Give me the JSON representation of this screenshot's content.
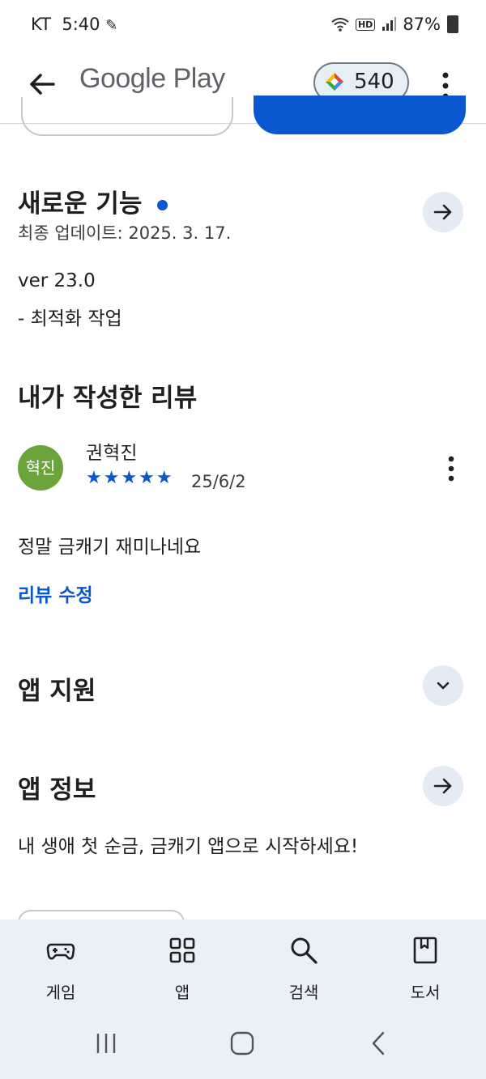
{
  "status_bar": {
    "carrier": "KT",
    "time": "5:40",
    "battery": "87%"
  },
  "app_bar": {
    "title": "Google Play",
    "points": "540"
  },
  "whats_new": {
    "title": "새로운 기능",
    "updated": "최종 업데이트: 2025. 3. 17.",
    "version": "ver 23.0",
    "note": "- 최적화 작업"
  },
  "my_review": {
    "title": "내가 작성한 리뷰",
    "avatar_text": "혁진",
    "reviewer": "권혁진",
    "stars": "★★★★★",
    "rating": 5,
    "date": "25/6/2",
    "text": "정말 금캐기 재미나네요",
    "edit_label": "리뷰 수정"
  },
  "app_support": {
    "title": "앱 지원"
  },
  "app_info": {
    "title": "앱 정보",
    "description": "내 생애 첫 순금, 금캐기 앱으로 시작하세요!"
  },
  "bottom_nav": [
    {
      "label": "게임",
      "icon": "gamepad-icon"
    },
    {
      "label": "앱",
      "icon": "apps-grid-icon"
    },
    {
      "label": "검색",
      "icon": "search-icon"
    },
    {
      "label": "도서",
      "icon": "book-icon"
    }
  ],
  "colors": {
    "accent": "#0b57d0",
    "avatar": "#6aa43b",
    "nav_bg": "#eaf0f7"
  }
}
